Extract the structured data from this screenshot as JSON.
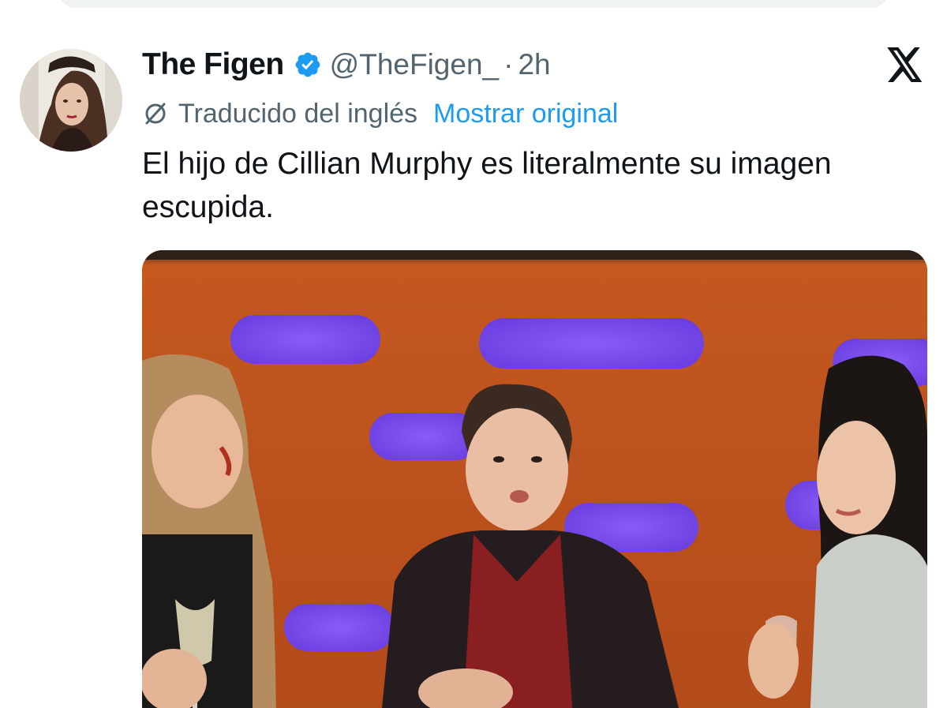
{
  "tweet": {
    "display_name": "The Figen",
    "handle": "@TheFigen_",
    "separator": "·",
    "time": "2h",
    "translation": {
      "label": "Traducido del inglés",
      "show_original": "Mostrar original"
    },
    "text_line1": "El hijo de Cillian Murphy es literalmente su imagen",
    "text_line2": "escupida."
  },
  "icons": {
    "verified": "verified-badge-icon",
    "translate": "translate-icon",
    "logo": "x-logo-icon"
  },
  "colors": {
    "text_primary": "#0f1419",
    "text_secondary": "#536471",
    "accent": "#1d9bf0"
  }
}
